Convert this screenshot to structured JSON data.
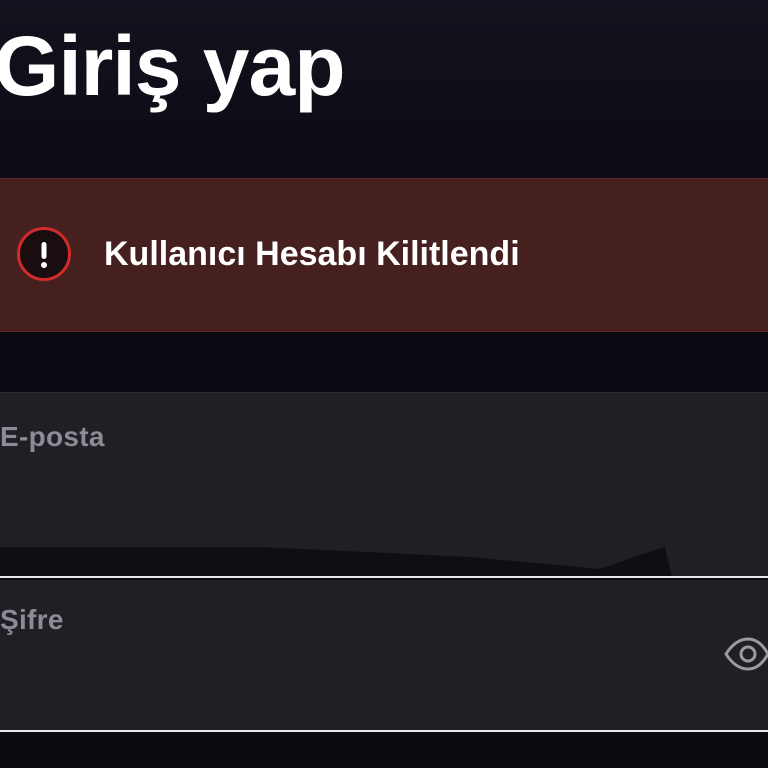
{
  "header": {
    "title": "Giriş yap"
  },
  "alert": {
    "message": "Kullanıcı Hesabı Kilitlendi",
    "icon": "exclamation-circle-icon",
    "icon_color": "#d22a2a",
    "background": "#45201f"
  },
  "form": {
    "email": {
      "label": "E-posta",
      "value": ""
    },
    "password": {
      "label": "Şifre",
      "value": "",
      "toggle_icon": "eye-icon"
    }
  }
}
